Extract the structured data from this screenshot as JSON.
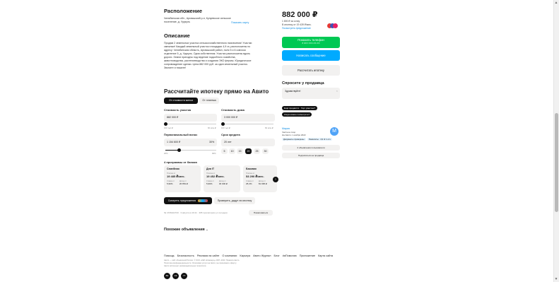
{
  "location": {
    "title": "Расположение",
    "address_line1": "Челябинская обл., Аргаяшский р-н, Кулуевское сельское",
    "address_line2": "поселение, д. Урукуль",
    "map_link": "Показать карту"
  },
  "description": {
    "title": "Описание",
    "lines": [
      "Продам 2 земельных участка сельскохозяйственного назначения! Участки",
      "смежные! Каждый земельный участок площадью 4,9 га, расположены по",
      "адресу: Челябинская область, Аргаяшский район, поля 5 и 6 совхоза",
      "отделение 5, д. Урукуль. Одна собственник. Участки расположены вдоль",
      "дороги. Земли пригодны под ведение подсобного хозяйства,",
      "животноводства, растениеводства и создания ЭКО фермы. Юридическое",
      "сопровождение сделки. Цена 882 000 руб. за один земельный участок.",
      "Звоните и пишите!"
    ]
  },
  "price": {
    "value": "882 000 ₽",
    "per_unit": "1 800 ₽ за сотку",
    "mortgage": "В ипотеку от 19 439 ₽/мес.",
    "mortgage_link": "Посмотреть предложение",
    "phone_button": "Показать телефон",
    "phone_sub": "8 9XX XXX-XX-XX",
    "message_button": "Написать сообщение",
    "calc_button": "Рассчитать ипотеку"
  },
  "ask": {
    "title": "Спросите у продавца",
    "placeholder": "Здравствуйте!",
    "chips": [
      "Ещё продаётся?",
      "Торг уместен?",
      "Когда можно посмотреть?"
    ]
  },
  "seller": {
    "name": "Мария",
    "type": "Частное лицо",
    "since": "На Авито с ноября 2022",
    "badge1": "Документы проверены",
    "badge2": "Реквизиты · 4,9 ★ 1 отз.",
    "ads_link": "2 объявления пользователя",
    "subscribe": "Подписаться на продавца",
    "avatar_letter": "М"
  },
  "mortgage_calc": {
    "title": "Рассчитайте ипотеку прямо на Авито",
    "tab_active": "От стоимости жилья",
    "tab_inactive": "От платежа",
    "cost_label": "Стоимость участка",
    "cost_value": "882 000 ₽",
    "cost_min": "100 тыс ₽",
    "cost_max": "60 млн ₽",
    "house_label": "Стоимость дома",
    "house_value": "3 000 000 ₽",
    "house_min": "100 тыс ₽",
    "house_max": "60 млн ₽",
    "down_label": "Первоначальный взнос",
    "down_value": "1 154 600 ₽",
    "down_pct": "30%",
    "down_min": "20%",
    "down_max": "90%",
    "term_label": "Срок кредита",
    "term_value": "20 лет",
    "term_options": [
      "5",
      "10",
      "15",
      "20",
      "25",
      "30"
    ],
    "term_selected": "20",
    "programs_title": "4 программы от банков",
    "programs": [
      {
        "name": "Семейная",
        "tag": "i",
        "pay_label": "Платеж от",
        "pay": "19 485 ₽/мес.",
        "rate_label": "Ставка от",
        "rate": "5,99%",
        "fee_label": "Доход от",
        "fee": "26 854 ₽"
      },
      {
        "name": "Для IT",
        "tag": "i",
        "pay_label": "Платеж от",
        "pay": "19 452 ₽/мес.",
        "rate_label": "Ставка от",
        "rate": "5,99%",
        "fee_label": "Доход от",
        "fee": "30 000 ₽"
      },
      {
        "name": "Базовая",
        "tag": "i",
        "pay_label": "Платеж от",
        "pay": "53 290 ₽/мес.",
        "rate_label": "Ставка от",
        "rate": "25,3%",
        "fee_label": "Доход от",
        "fee": "81 995 ₽"
      }
    ],
    "offers_button": "Смотреть предложения",
    "check_button": "Проверить, дадут ли ипотеку"
  },
  "meta": {
    "info": "№ 4726422720 · 3 августа в 19:11 · 305 просмотров (+1 сегодня)",
    "complain": "Пожаловаться"
  },
  "similar": {
    "title": "Похожие объявления"
  },
  "footer": {
    "links": [
      "Помощь",
      "Безопасность",
      "Реклама на сайте",
      "О компании",
      "Карьера",
      "Авито Журнал",
      "Блог",
      "#яПомогаю",
      "Приложение",
      "Карта сайта"
    ],
    "legal1": "Авито — сайт объявлений России. © ООО «КЕХ еКоммерц» 2007–2023. Правила Авито.",
    "legal2": "Политика конфиденциальности. Оплачивая услуги на Авито, вы принимаете оферту.",
    "legal3": "Авито использует рекомендательные технологии.",
    "social": [
      "ВК",
      "ОК",
      "YT"
    ]
  },
  "colors": {
    "green": "#00c853",
    "blue": "#00aaff",
    "gray_bg": "#f2f1f0",
    "dark": "#111111"
  }
}
